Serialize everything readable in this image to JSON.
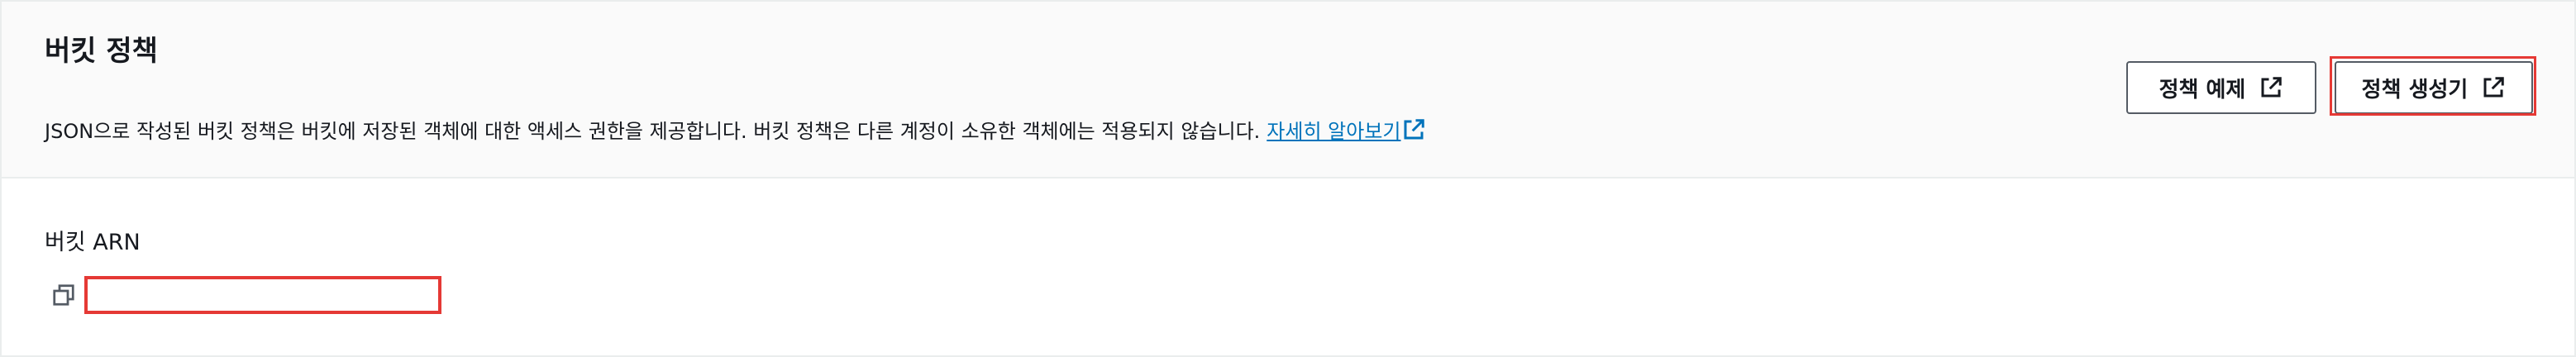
{
  "header": {
    "title": "버킷 정책",
    "description": "JSON으로 작성된 버킷 정책은 버킷에 저장된 객체에 대한 액세스 권한을 제공합니다. 버킷 정책은 다른 계정이 소유한 객체에는 적용되지 않습니다.",
    "learn_more_label": "자세히 알아보기"
  },
  "actions": {
    "policy_examples_label": "정책 예제",
    "policy_generator_label": "정책 생성기"
  },
  "arn": {
    "label": "버킷 ARN",
    "value": ""
  },
  "icons": {
    "external_link": "external-link-icon",
    "copy": "copy-icon"
  },
  "colors": {
    "link": "#0073bb",
    "highlight": "#e53935",
    "header_bg": "#fafafa",
    "border": "#eaeded"
  }
}
